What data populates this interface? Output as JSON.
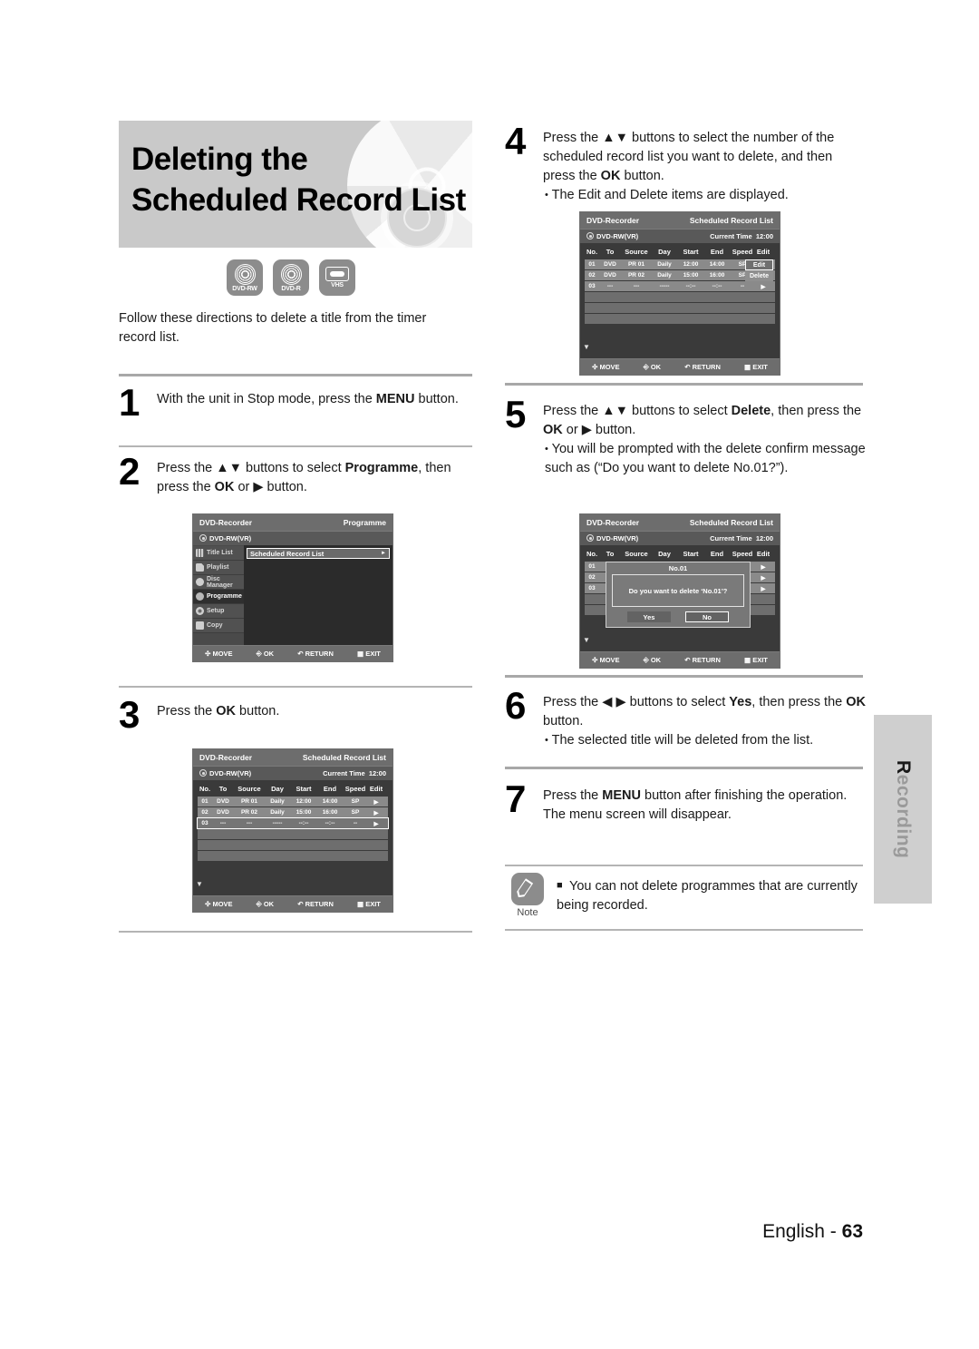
{
  "title": {
    "line1": "Deleting the",
    "line2": "Scheduled Record List"
  },
  "media_icons": [
    {
      "name": "dvd-rw-icon",
      "label": "DVD-RW"
    },
    {
      "name": "dvd-r-icon",
      "label": "DVD-R"
    },
    {
      "name": "vhs-icon",
      "label": "VHS"
    }
  ],
  "intro": "Follow these directions to delete a title from the timer record list.",
  "steps": {
    "s1": {
      "num": "1",
      "text_a": "With the unit in Stop mode, press the ",
      "bold_a": "MENU",
      "text_b": " button."
    },
    "s2": {
      "num": "2",
      "text_a": "Press the ▲▼ buttons to select ",
      "bold_a": "Programme",
      "text_b": ", then press the ",
      "bold_b": "OK",
      "text_c": " or ▶ button."
    },
    "s3": {
      "num": "3",
      "text_a": "Press the ",
      "bold_a": "OK",
      "text_b": " button."
    },
    "s4": {
      "num": "4",
      "text_a": "Press the ▲▼ buttons to select the number of the scheduled record list you want to delete, and then press the ",
      "bold_a": "OK",
      "text_b": " button.",
      "bullet": "The Edit and Delete items are displayed."
    },
    "s5": {
      "num": "5",
      "text_a": "Press the ▲▼  buttons to select ",
      "bold_a": "Delete",
      "text_b": ", then press the ",
      "bold_b": "OK",
      "text_c": " or ▶ button.",
      "bullet": "You will be prompted with the delete confirm message such as (“Do you want to delete No.01?”)."
    },
    "s6": {
      "num": "6",
      "text_a": "Press the ◀ ▶ buttons to select ",
      "bold_a": "Yes",
      "text_b": ", then press the ",
      "bold_b": "OK",
      "text_c": " button.",
      "bullet": "The selected title will be deleted from the list."
    },
    "s7": {
      "num": "7",
      "text_a": "Press the ",
      "bold_a": "MENU",
      "text_b": " button after finishing the operation. The menu screen will disappear."
    }
  },
  "screens": {
    "common": {
      "device": "DVD-Recorder",
      "disc": "DVD-RW(VR)",
      "footer": {
        "move": "MOVE",
        "ok": "OK",
        "return": "RETURN",
        "exit": "EXIT"
      }
    },
    "programme": {
      "header_right": "Programme",
      "menu_items": [
        {
          "icon": "film-icon",
          "label": "Title List",
          "selected": false
        },
        {
          "icon": "playlist-icon",
          "label": "Playlist",
          "selected": false
        },
        {
          "icon": "disc-manager-icon",
          "label": "Disc Manager",
          "selected": false
        },
        {
          "icon": "programme-icon",
          "label": "Programme",
          "selected": true
        },
        {
          "icon": "gear-icon",
          "label": "Setup",
          "selected": false
        },
        {
          "icon": "copy-icon",
          "label": "Copy",
          "selected": false
        }
      ],
      "entry": "Scheduled Record List"
    },
    "record_list": {
      "header_right": "Scheduled Record List",
      "current_time_label": "Current Time",
      "current_time": "12:00",
      "columns": [
        "No.",
        "To",
        "Source",
        "Day",
        "Start",
        "End",
        "Speed",
        "Edit"
      ],
      "rows": [
        {
          "no": "01",
          "to": "DVD",
          "source": "PR 01",
          "day": "Daily",
          "start": "12:00",
          "end": "14:00",
          "speed": "SP",
          "edit": "▶"
        },
        {
          "no": "02",
          "to": "DVD",
          "source": "PR 02",
          "day": "Daily",
          "start": "15:00",
          "end": "16:00",
          "speed": "SP",
          "edit": "▶"
        },
        {
          "no": "03",
          "to": "---",
          "source": "---",
          "day": "-----",
          "start": "--:--",
          "end": "--:--",
          "speed": "--",
          "edit": "▶"
        }
      ]
    },
    "edit_dropdown": {
      "edit": "Edit",
      "delete": "Delete"
    },
    "confirm_dialog": {
      "title": "No.01",
      "message": "Do you want to delete ‘No.01’?",
      "yes": "Yes",
      "no": "No"
    }
  },
  "note": {
    "label": "Note",
    "bullet": "■",
    "text": "You can not delete programmes that are currently being recorded."
  },
  "side_tab": {
    "first": "R",
    "rest": "ecording"
  },
  "footer": {
    "language": "English",
    "dash": "-",
    "page": "63"
  }
}
